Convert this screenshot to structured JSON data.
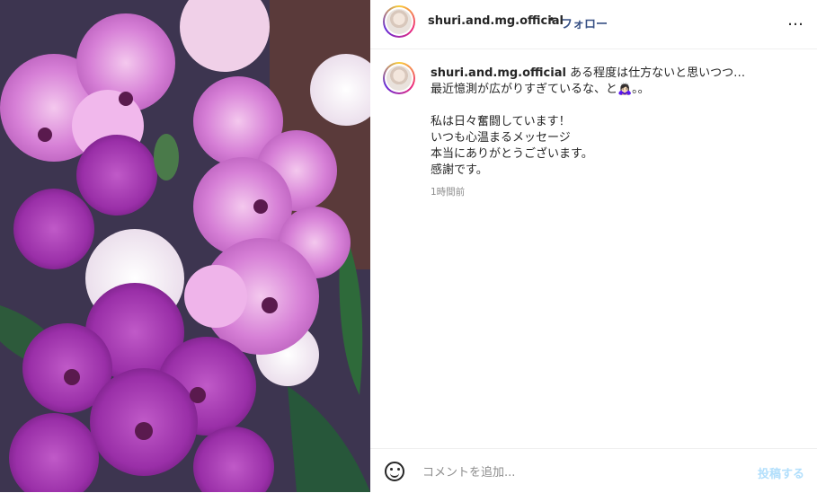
{
  "post": {
    "username": "shuri.and.mg.official",
    "follow_label": "フォロー",
    "separator": "•",
    "more_icon": "…",
    "caption_lines": [
      "ある程度は仕方ないと思いつつ…",
      "最近憶測が広がりすぎているな、と🙇🏻‍♀️。。",
      "私は日々奮闘しています！",
      "いつも心温まるメッセージ",
      "本当にありがとうございます。",
      "感謝です。"
    ],
    "timestamp": "1時間前"
  },
  "comment_box": {
    "placeholder": "コメントを追加...",
    "post_label": "投稿する"
  },
  "colors": {
    "follow": "#385185",
    "post_disabled": "#b2dffc"
  }
}
